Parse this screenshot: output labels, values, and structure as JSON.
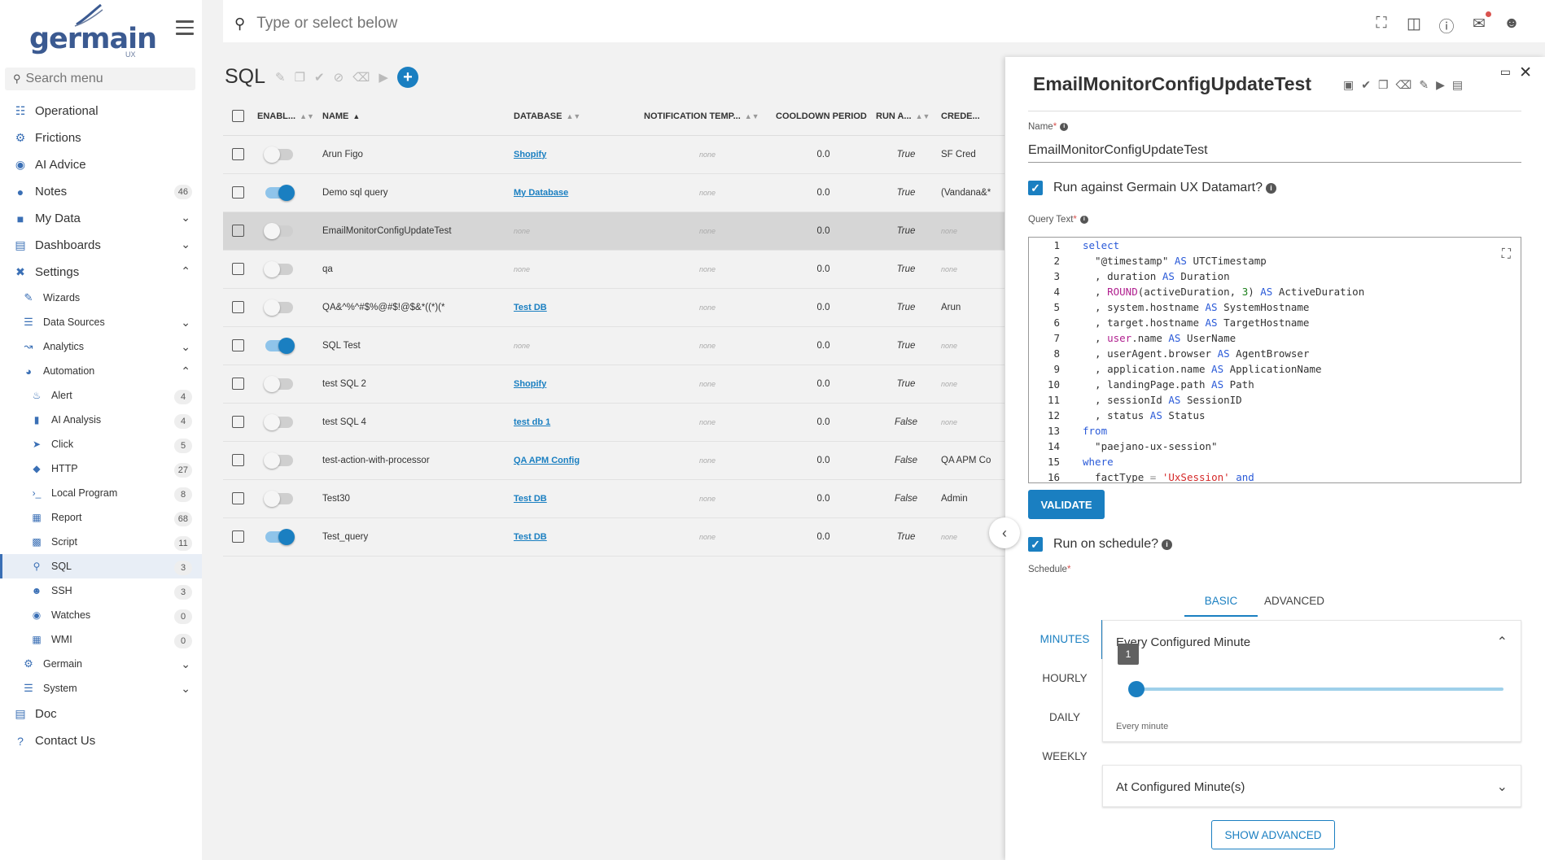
{
  "sidebar": {
    "logo_text": "germain",
    "logo_sub": "UX",
    "search_placeholder": "Search menu",
    "items": [
      {
        "label": "Operational",
        "icon": "sitemap-icon"
      },
      {
        "label": "Frictions",
        "icon": "friction-icon"
      },
      {
        "label": "AI Advice",
        "icon": "brain-icon"
      },
      {
        "label": "Notes",
        "icon": "comment-icon",
        "badge": "46"
      },
      {
        "label": "My Data",
        "icon": "database-icon"
      },
      {
        "label": "Dashboards",
        "icon": "chart-icon"
      },
      {
        "label": "Settings",
        "icon": "tools-icon"
      }
    ],
    "settings_children": [
      {
        "label": "Wizards",
        "icon": "wand-icon"
      },
      {
        "label": "Data Sources",
        "icon": "database-icon"
      },
      {
        "label": "Analytics",
        "icon": "line-chart-icon"
      },
      {
        "label": "Automation",
        "icon": "robot-icon"
      }
    ],
    "automation_children": [
      {
        "label": "Alert",
        "icon": "bell-icon",
        "badge": "4"
      },
      {
        "label": "AI Analysis",
        "icon": "file-icon",
        "badge": "4"
      },
      {
        "label": "Click",
        "icon": "cursor-icon",
        "badge": "5"
      },
      {
        "label": "HTTP",
        "icon": "diamond-icon",
        "badge": "27"
      },
      {
        "label": "Local Program",
        "icon": "terminal-icon",
        "badge": "8"
      },
      {
        "label": "Report",
        "icon": "report-icon",
        "badge": "68"
      },
      {
        "label": "Script",
        "icon": "script-icon",
        "badge": "11"
      },
      {
        "label": "SQL",
        "icon": "search-icon",
        "badge": "3"
      },
      {
        "label": "SSH",
        "icon": "linux-icon",
        "badge": "3"
      },
      {
        "label": "Watches",
        "icon": "eye-icon",
        "badge": "0"
      },
      {
        "label": "WMI",
        "icon": "windows-icon",
        "badge": "0"
      }
    ],
    "bottom_children": [
      {
        "label": "Germain",
        "icon": "cogs-icon"
      },
      {
        "label": "System",
        "icon": "server-icon"
      }
    ],
    "footer": [
      {
        "label": "Doc",
        "icon": "book-icon"
      },
      {
        "label": "Contact Us",
        "icon": "question-icon"
      }
    ]
  },
  "topbar": {
    "search_placeholder": "Type or select below"
  },
  "list": {
    "title": "SQL",
    "columns": [
      "ENABL...",
      "NAME",
      "DATABASE",
      "NOTIFICATION TEMP...",
      "COOLDOWN PERIOD",
      "RUN A...",
      "CREDE..."
    ],
    "rows": [
      {
        "enabled": false,
        "name": "Arun Figo",
        "database": "Shopify",
        "notification": "none",
        "cooldown": "0.0",
        "run": "True",
        "cred": "SF Cred"
      },
      {
        "enabled": true,
        "name": "Demo sql query",
        "database": "My Database",
        "notification": "none",
        "cooldown": "0.0",
        "run": "True",
        "cred": "(Vandana&*"
      },
      {
        "enabled": false,
        "name": "EmailMonitorConfigUpdateTest",
        "database": "none",
        "notification": "none",
        "cooldown": "0.0",
        "run": "True",
        "cred": "none",
        "selected": true
      },
      {
        "enabled": false,
        "name": "qa",
        "database": "none",
        "notification": "none",
        "cooldown": "0.0",
        "run": "True",
        "cred": "none"
      },
      {
        "enabled": false,
        "name": "QA&^%^#$%@#$!@$&*((*)(*",
        "database": "Test DB",
        "notification": "none",
        "cooldown": "0.0",
        "run": "True",
        "cred": "Arun"
      },
      {
        "enabled": true,
        "name": "SQL Test",
        "database": "none",
        "notification": "none",
        "cooldown": "0.0",
        "run": "True",
        "cred": "none"
      },
      {
        "enabled": false,
        "name": "test SQL 2",
        "database": "Shopify",
        "notification": "none",
        "cooldown": "0.0",
        "run": "True",
        "cred": "none"
      },
      {
        "enabled": false,
        "name": "test SQL 4",
        "database": "test db 1",
        "notification": "none",
        "cooldown": "0.0",
        "run": "False",
        "cred": "none"
      },
      {
        "enabled": false,
        "name": "test-action-with-processor",
        "database": "QA APM Config",
        "notification": "none",
        "cooldown": "0.0",
        "run": "False",
        "cred": "QA APM Co"
      },
      {
        "enabled": false,
        "name": "Test30",
        "database": "Test DB",
        "notification": "none",
        "cooldown": "0.0",
        "run": "False",
        "cred": "Admin"
      },
      {
        "enabled": true,
        "name": "Test_query",
        "database": "Test DB",
        "notification": "none",
        "cooldown": "0.0",
        "run": "True",
        "cred": "none"
      }
    ]
  },
  "detail": {
    "title": "EmailMonitorConfigUpdateTest",
    "name_label": "Name",
    "name_value": "EmailMonitorConfigUpdateTest",
    "datamart_label": "Run against Germain UX Datamart?",
    "query_label": "Query Text",
    "code_lines": [
      "select",
      "  \"@timestamp\" AS UTCTimestamp",
      "  , duration AS Duration",
      "  , ROUND(activeDuration, 3) AS ActiveDuration",
      "  , system.hostname AS SystemHostname",
      "  , target.hostname AS TargetHostname",
      "  , user.name AS UserName",
      "  , userAgent.browser AS AgentBrowser",
      "  , application.name AS ApplicationName",
      "  , landingPage.path AS Path",
      "  , sessionId AS SessionID",
      "  , status AS Status",
      "from",
      "  \"paejano-ux-session\"",
      "where",
      "  factType = 'UxSession' and"
    ],
    "validate_label": "VALIDATE",
    "schedule_check_label": "Run on schedule?",
    "schedule_label": "Schedule",
    "tabs": [
      "BASIC",
      "ADVANCED"
    ],
    "vtabs": [
      "MINUTES",
      "HOURLY",
      "DAILY",
      "WEEKLY"
    ],
    "acc1_title": "Every Configured Minute",
    "slider_value": "1",
    "slider_caption": "Every minute",
    "acc2_title": "At Configured Minute(s)",
    "show_advanced_label": "SHOW ADVANCED"
  }
}
